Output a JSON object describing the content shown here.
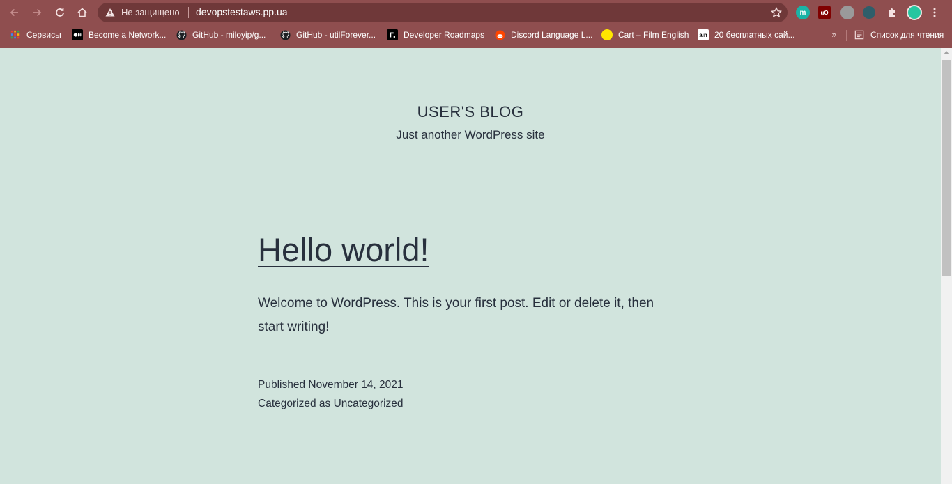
{
  "browser": {
    "security_label": "Не защищено",
    "url": "devopstestaws.pp.ua",
    "colors": {
      "frame": "#8f4e4f",
      "omnibox": "#6f3839"
    },
    "toolbar_icons": [
      "back-arrow-icon",
      "forward-arrow-icon",
      "reload-icon",
      "home-icon"
    ],
    "extensions": [
      {
        "name": "extension-m-icon",
        "glyph": "m",
        "color": "#1ab3a6"
      },
      {
        "name": "ublock-icon",
        "glyph": "uo",
        "color": "#800000"
      },
      {
        "name": "extension-gray-icon",
        "glyph": "",
        "color": "#9a9a9a"
      },
      {
        "name": "extension-dark-icon",
        "glyph": "",
        "color": "#2e5e6a"
      },
      {
        "name": "puzzle-icon",
        "glyph": "",
        "color": ""
      },
      {
        "name": "profile-avatar-icon",
        "glyph": "",
        "color": "#26c6a0"
      },
      {
        "name": "menu-dots-icon",
        "glyph": "",
        "color": ""
      }
    ]
  },
  "bookmarks": {
    "items": [
      {
        "label": "Сервисы",
        "icon": "apps-grid-icon"
      },
      {
        "label": "Become a Network...",
        "icon": "medium-icon"
      },
      {
        "label": "GitHub - miloyip/g...",
        "icon": "github-icon"
      },
      {
        "label": "GitHub - utilForever...",
        "icon": "github-icon"
      },
      {
        "label": "Developer Roadmaps",
        "icon": "roadmap-icon"
      },
      {
        "label": "Discord Language L...",
        "icon": "reddit-icon"
      },
      {
        "label": "Cart – Film English",
        "icon": "yellow-circle-icon"
      },
      {
        "label": "20 бесплатных сай...",
        "icon": "ain-icon"
      }
    ],
    "overflow": "»",
    "reading_list": "Список для чтения"
  },
  "site": {
    "title": "USER'S BLOG",
    "description": "Just another WordPress site",
    "background": "#d1e4dd"
  },
  "post": {
    "title": "Hello world!",
    "body": "Welcome to WordPress. This is your first post. Edit or delete it, then start writing!",
    "published": "Published November 14, 2021",
    "categorized_prefix": "Categorized as ",
    "category": "Uncategorized"
  }
}
